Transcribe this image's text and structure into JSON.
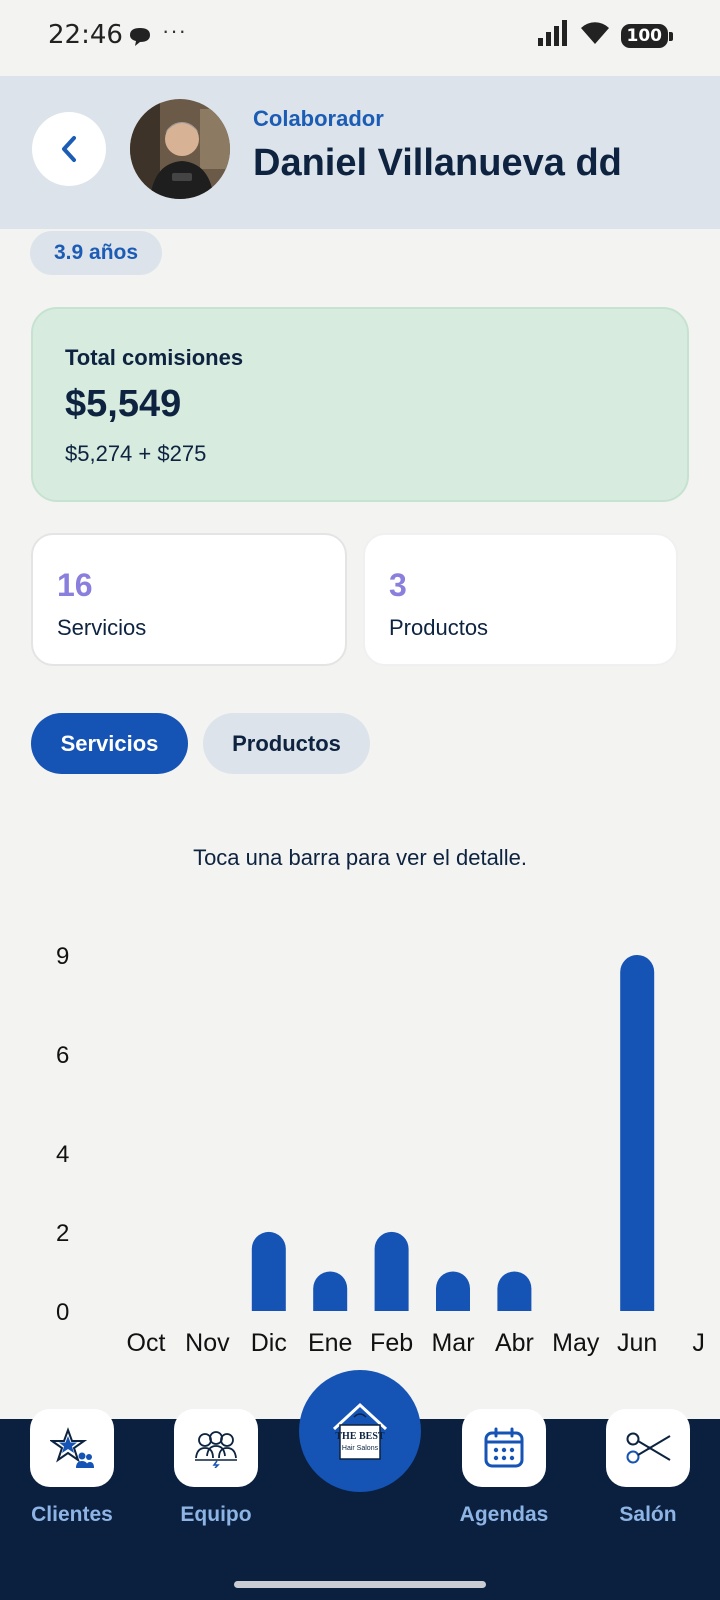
{
  "status_bar": {
    "time": "22:46",
    "dots": "···",
    "battery": "100"
  },
  "header": {
    "role": "Colaborador",
    "name": "Daniel Villanueva dd"
  },
  "tenure_badge": "3.9 años",
  "total_card": {
    "label": "Total comisiones",
    "amount": "$5,549",
    "breakdown": "$5,274 + $275"
  },
  "stats": [
    {
      "value": "16",
      "label": "Servicios"
    },
    {
      "value": "3",
      "label": "Productos"
    }
  ],
  "tabs": [
    {
      "label": "Servicios",
      "active": true
    },
    {
      "label": "Productos",
      "active": false
    }
  ],
  "hint": "Toca una barra para ver el detalle.",
  "chart_data": {
    "type": "bar",
    "categories": [
      "Oct",
      "Nov",
      "Dic",
      "Ene",
      "Feb",
      "Mar",
      "Abr",
      "May",
      "Jun",
      "J"
    ],
    "values": [
      0,
      0,
      2,
      1,
      2,
      1,
      1,
      0,
      9,
      0
    ],
    "y_ticks": [
      "0",
      "2",
      "4",
      "6",
      "9"
    ],
    "ylim": [
      0,
      9
    ],
    "bar_color": "#1553b5"
  },
  "nav": {
    "items": [
      {
        "label": "Clientes",
        "icon": "star-people-icon"
      },
      {
        "label": "Equipo",
        "icon": "team-icon"
      },
      {
        "label": "Agendas",
        "icon": "calendar-icon"
      },
      {
        "label": "Salón",
        "icon": "scissors-icon"
      }
    ],
    "home_logo_line1": "THE BEST",
    "home_logo_line2": "Hair Salons"
  },
  "colors": {
    "accent": "#1553b5",
    "nav_bg": "#0a203e",
    "stat_number": "#8a7fdc",
    "card_green": "#d7ebdf"
  }
}
